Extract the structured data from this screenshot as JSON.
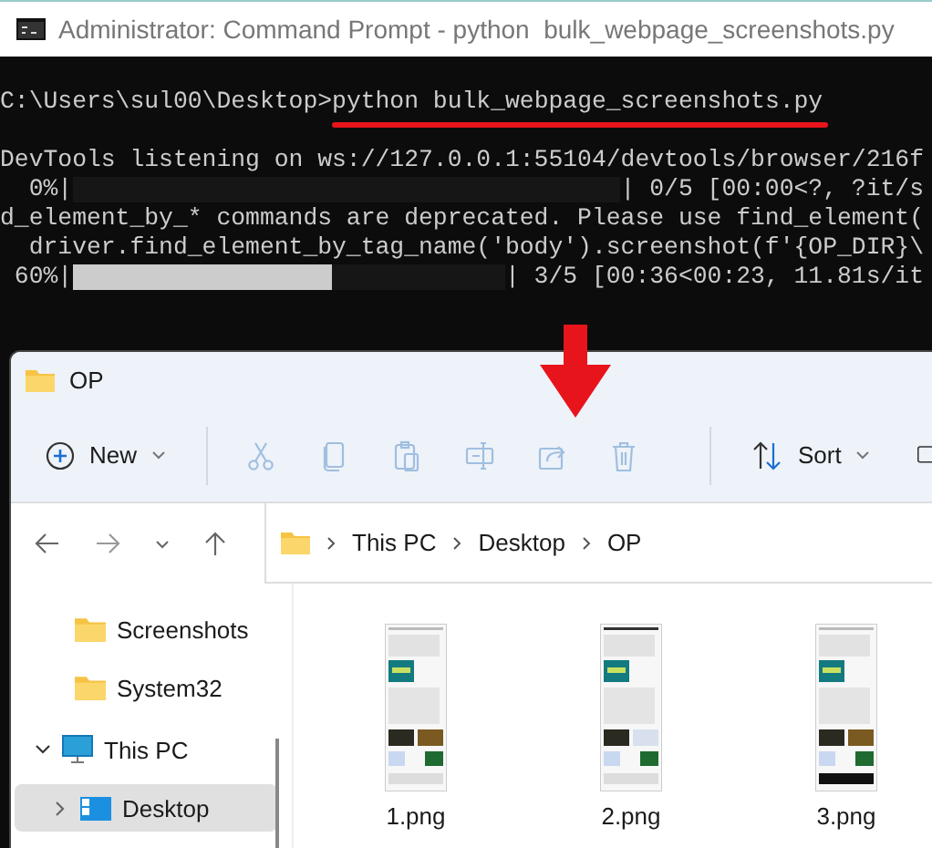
{
  "cmd": {
    "title": "Administrator: Command Prompt - python  bulk_webpage_screenshots.py",
    "lines": [
      {
        "kind": "command",
        "prompt": "C:\\Users\\sul00\\Desktop>",
        "text": "python bulk_webpage_screenshots.py"
      },
      {
        "kind": "text",
        "text": "DevTools listening on ws://127.0.0.1:55104/devtools/browser/216f"
      },
      {
        "kind": "progress",
        "prefix": "  0%|",
        "suffix": "| 0/5 [00:00<?, ?it/s"
      },
      {
        "kind": "text",
        "text": "d_element_by_* commands are deprecated. Please use find_element("
      },
      {
        "kind": "text",
        "text": "  driver.find_element_by_tag_name('body').screenshot(f'{OP_DIR}\\"
      },
      {
        "kind": "progress",
        "prefix": " 60%|",
        "level": 0.6,
        "suffix": "| 3/5 [00:36<00:23, 11.81s/it"
      }
    ]
  },
  "explorer": {
    "title": "OP",
    "toolbar": {
      "new_label": "New",
      "sort_label": "Sort",
      "actions": [
        {
          "disabled": true
        },
        {
          "disabled": true
        },
        {
          "disabled": true
        },
        {
          "disabled": true
        },
        {
          "disabled": true
        },
        {
          "disabled": true
        }
      ]
    },
    "breadcrumb": [
      "This PC",
      "Desktop",
      "OP"
    ],
    "sidebar": [
      {
        "kind": "folder",
        "label": "Screenshots",
        "selected": false
      },
      {
        "kind": "folder",
        "label": "System32",
        "selected": false
      },
      {
        "kind": "pc",
        "label": "This PC",
        "selected": false,
        "expanded": true,
        "children": [
          {
            "kind": "desktop",
            "label": "Desktop",
            "selected": true,
            "expanded": false
          }
        ]
      }
    ],
    "files": [
      {
        "name": "1.png",
        "kind": "picture"
      },
      {
        "name": "2.png",
        "kind": "picture"
      },
      {
        "name": "3.png",
        "kind": "picture"
      }
    ]
  }
}
